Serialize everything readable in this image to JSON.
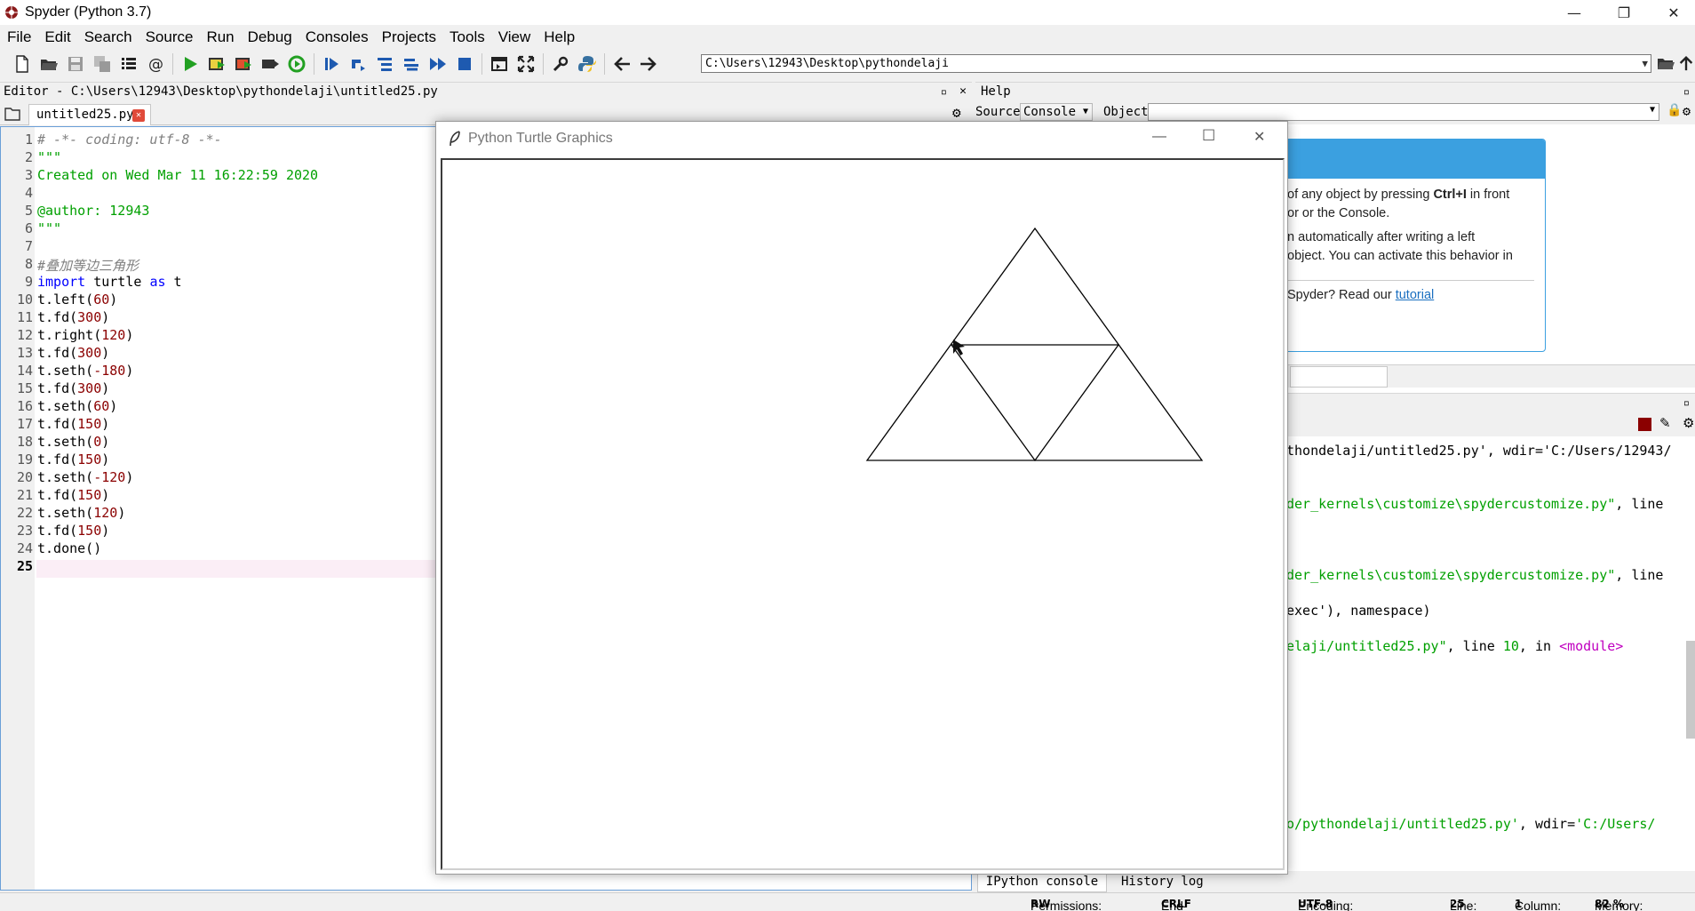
{
  "window": {
    "title": "Spyder (Python 3.7)",
    "minimize": "—",
    "restore": "❐",
    "close": "✕"
  },
  "menu": [
    "File",
    "Edit",
    "Search",
    "Source",
    "Run",
    "Debug",
    "Consoles",
    "Projects",
    "Tools",
    "View",
    "Help"
  ],
  "toolbar": {
    "path": "C:\\Users\\12943\\Desktop\\pythondelaji"
  },
  "editor": {
    "header": "Editor - C:\\Users\\12943\\Desktop\\pythondelaji\\untitled25.py",
    "tab": "untitled25.py",
    "current_line": 25,
    "line_numbers": [
      "1",
      "2",
      "3",
      "4",
      "5",
      "6",
      "7",
      "8",
      "9",
      "10",
      "11",
      "12",
      "13",
      "14",
      "15",
      "16",
      "17",
      "18",
      "19",
      "20",
      "21",
      "22",
      "23",
      "24",
      "25"
    ]
  },
  "help": {
    "header": "Help",
    "source_label": "Source",
    "source_value": "Console",
    "object_label": "Object",
    "text_1a": "of any object by pressing ",
    "text_1b": "Ctrl+I",
    "text_1c": " in front",
    "text_2": "or or the Console.",
    "text_3": "n automatically after writing a left",
    "text_4": "object. You can activate this behavior in",
    "text_5": "Spyder? Read our ",
    "tutorial": "tutorial"
  },
  "console": {
    "l1": "thondelaji/untitled25.py', wdir='C:/Users/12943/",
    "l2a": "der_kernels\\customize\\spydercustomize.py\"",
    "l2b": ", line",
    "l3a": "der_kernels\\customize\\spydercustomize.py\"",
    "l3b": ", line",
    "l4": "exec'), namespace)",
    "l5a": "elaji/untitled25.py\"",
    "l5b": ", line ",
    "l5c": "10",
    "l5d": ", in ",
    "l5e": "<module>",
    "l6a": "o/pythondelaji/untitled25.py'",
    "l6b": ", wdir=",
    "l6c": "'C:/Users/",
    "tab_ipython": "IPython console",
    "tab_history": "History log"
  },
  "turtle": {
    "title": "Python Turtle Graphics"
  },
  "status": {
    "perm_label": "Permissions:",
    "perm": "RW",
    "eol_label": "End-of-lines:",
    "eol": "CRLF",
    "enc_label": "Encoding:",
    "enc": "UTF-8",
    "line_label": "Line:",
    "line": "25",
    "col_label": "Column:",
    "col": "1",
    "mem_label": "Memory:",
    "mem": "82 %"
  },
  "code": {
    "l1": "# -*- coding: utf-8 -*-",
    "l2": "\"\"\"",
    "l3": "Created on Wed Mar 11 16:22:59 2020",
    "l5": "@author: 12943",
    "l6": "\"\"\"",
    "l8": "#叠加等边三角形",
    "l9a": "import",
    "l9b": " turtle ",
    "l9c": "as",
    "l9d": " t",
    "calls": [
      {
        "fn": "t.left(",
        "arg": "60",
        "end": ")"
      },
      {
        "fn": "t.fd(",
        "arg": "300",
        "end": ")"
      },
      {
        "fn": "t.right(",
        "arg": "120",
        "end": ")"
      },
      {
        "fn": "t.fd(",
        "arg": "300",
        "end": ")"
      },
      {
        "fn": "t.seth(",
        "arg": "-180",
        "end": ")"
      },
      {
        "fn": "t.fd(",
        "arg": "300",
        "end": ")"
      },
      {
        "fn": "t.seth(",
        "arg": "60",
        "end": ")"
      },
      {
        "fn": "t.fd(",
        "arg": "150",
        "end": ")"
      },
      {
        "fn": "t.seth(",
        "arg": "0",
        "end": ")"
      },
      {
        "fn": "t.fd(",
        "arg": "150",
        "end": ")"
      },
      {
        "fn": "t.seth(",
        "arg": "-120",
        "end": ")"
      },
      {
        "fn": "t.fd(",
        "arg": "150",
        "end": ")"
      },
      {
        "fn": "t.seth(",
        "arg": "120",
        "end": ")"
      },
      {
        "fn": "t.fd(",
        "arg": "150",
        "end": ")"
      },
      {
        "fn": "t.done()",
        "arg": "",
        "end": ""
      }
    ]
  }
}
